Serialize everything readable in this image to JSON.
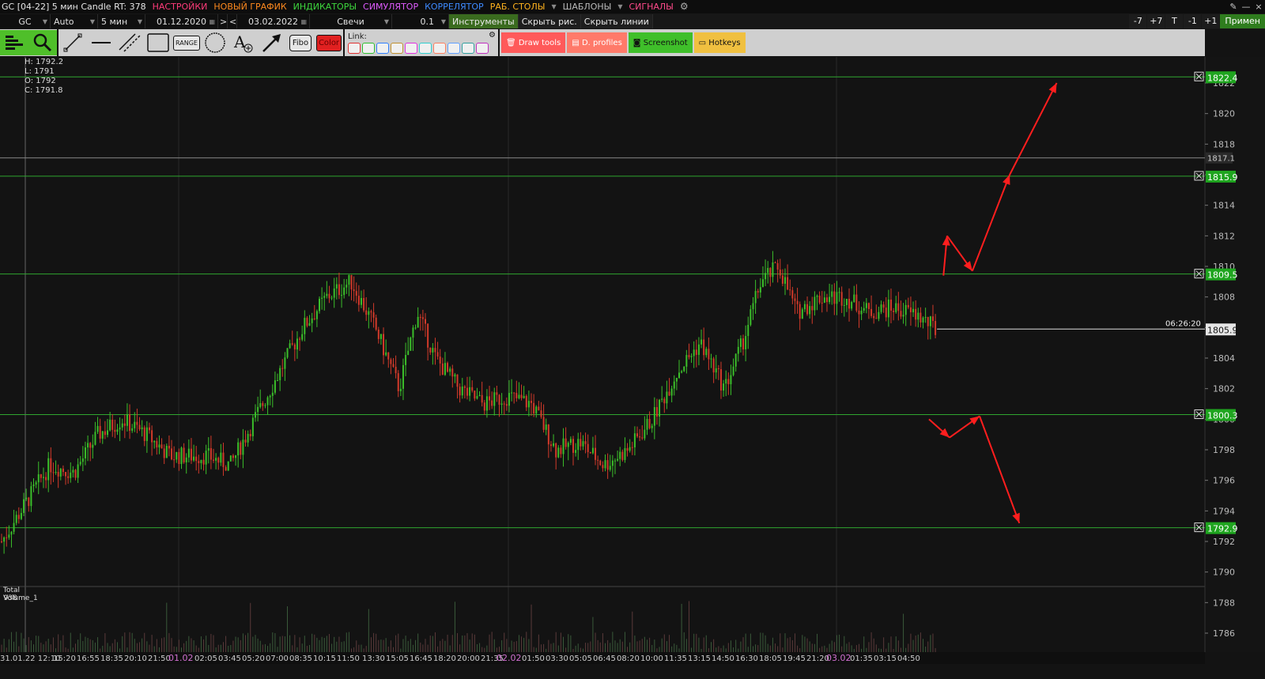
{
  "menu": {
    "title": "GC [04-22] 5 мин Candle RT: 378",
    "items": [
      {
        "label": "НАСТРОЙКИ",
        "color": "#ff3b7a"
      },
      {
        "label": "НОВЫЙ ГРАФИК",
        "color": "#ff8a1e"
      },
      {
        "label": "ИНДИКАТОРЫ",
        "color": "#3dd63d"
      },
      {
        "label": "СИМУЛЯТОР",
        "color": "#e05cff"
      },
      {
        "label": "КОРРЕЛЯТОР",
        "color": "#3d8aff"
      },
      {
        "label": "РАБ. СТОЛЫ",
        "color": "#ffb21e"
      },
      {
        "label": "ШАБЛОНЫ",
        "color": "#bbbbbb"
      },
      {
        "label": "СИГНАЛЫ",
        "color": "#ff4a8a"
      }
    ],
    "pin": "✎",
    "minimize": "—",
    "close": "×"
  },
  "toolbar": {
    "symbol": "GC",
    "mode": "Auto",
    "timeframe": "5 мин",
    "date_from": "01.12.2020",
    "nav_right": ">",
    "nav_left": "<",
    "date_to": "03.02.2022",
    "chart_type": "Свечи",
    "step": "0.1",
    "tools_label": "Инструменты",
    "hide_drawings": "Скрыть рис.",
    "hide_lines": "Скрыть линии",
    "zoom_minus7": "-7",
    "zoom_plus7": "+7",
    "zoom_t": "T",
    "zoom_minus1": "-1",
    "zoom_plus1": "+1",
    "apply": "Примен"
  },
  "drawbar": {
    "range_label": "RANGE",
    "fibo_label": "Fibo",
    "color_label": "Color",
    "link_label": "Link:",
    "link_colors": [
      "#e03030",
      "#30c030",
      "#3080ff",
      "#c09030",
      "#e030e0",
      "#30d0d0",
      "#ff8060",
      "#60a0ff",
      "#30a0a0",
      "#c030c0"
    ],
    "draw_tools": "Draw tools",
    "d_profiles": "D. profiles",
    "screenshot": "Screenshot",
    "hotkeys": "Hotkeys",
    "colors": {
      "draw_tools": "#ff5a5a",
      "d_profiles": "#ff7a6a",
      "screenshot": "#3fbf2a",
      "hotkeys": "#f0c040"
    }
  },
  "ohlc": {
    "h": "H: 1792.2",
    "l": "L: 1791",
    "o": "O: 1792",
    "c": "C: 1791.8"
  },
  "volume_label": "Total Volume_1",
  "volume_value": "938",
  "current_time": "06:26:20",
  "current_price": "1805.9",
  "price_ticks": [
    "1822",
    "1820",
    "1818",
    "1816",
    "1814",
    "1812",
    "1810",
    "1808",
    "1806",
    "1804",
    "1802",
    "1800",
    "1798",
    "1796",
    "1794",
    "1792",
    "1790",
    "1788",
    "1786"
  ],
  "levels": [
    {
      "price": "1822.4",
      "color": "#2fa52f"
    },
    {
      "price": "1815.9",
      "color": "#2fa52f"
    },
    {
      "price": "1809.5",
      "color": "#2fa52f"
    },
    {
      "price": "1800.3",
      "color": "#2fa52f"
    },
    {
      "price": "1792.9",
      "color": "#2fa52f"
    }
  ],
  "grey_level": "1817.1",
  "time_labels": [
    "31.01.22 12:10",
    "15:20",
    "16:55",
    "18:35",
    "20:10",
    "21:50",
    "01.02",
    "02:05",
    "03:45",
    "05:20",
    "07:00",
    "08:35",
    "10:15",
    "11:50",
    "13:30",
    "15:05",
    "16:45",
    "18:20",
    "20:00",
    "21:35",
    "02.02",
    "01:50",
    "03:30",
    "05:05",
    "06:45",
    "08:20",
    "10:00",
    "11:35",
    "13:15",
    "14:50",
    "16:30",
    "18:05",
    "19:45",
    "21:20",
    "03.02",
    "01:35",
    "03:15",
    "04:50"
  ],
  "chart_data": {
    "type": "candlestick",
    "title": "GC [04-22] 5 мин Candle",
    "ylim": [
      1785,
      1823
    ],
    "close_path": [
      {
        "t": 0,
        "p": 1792
      },
      {
        "t": 0.04,
        "p": 1797
      },
      {
        "t": 0.06,
        "p": 1796.5
      },
      {
        "t": 0.08,
        "p": 1799
      },
      {
        "t": 0.1,
        "p": 1800
      },
      {
        "t": 0.12,
        "p": 1799
      },
      {
        "t": 0.14,
        "p": 1797.6
      },
      {
        "t": 0.17,
        "p": 1797.6
      },
      {
        "t": 0.19,
        "p": 1797
      },
      {
        "t": 0.21,
        "p": 1800
      },
      {
        "t": 0.23,
        "p": 1803
      },
      {
        "t": 0.25,
        "p": 1806
      },
      {
        "t": 0.27,
        "p": 1808
      },
      {
        "t": 0.29,
        "p": 1809
      },
      {
        "t": 0.31,
        "p": 1806
      },
      {
        "t": 0.33,
        "p": 1802
      },
      {
        "t": 0.345,
        "p": 1807
      },
      {
        "t": 0.36,
        "p": 1804
      },
      {
        "t": 0.38,
        "p": 1802
      },
      {
        "t": 0.4,
        "p": 1801
      },
      {
        "t": 0.42,
        "p": 1801.5
      },
      {
        "t": 0.44,
        "p": 1801
      },
      {
        "t": 0.46,
        "p": 1798
      },
      {
        "t": 0.48,
        "p": 1798.5
      },
      {
        "t": 0.5,
        "p": 1797
      },
      {
        "t": 0.52,
        "p": 1798
      },
      {
        "t": 0.54,
        "p": 1800
      },
      {
        "t": 0.56,
        "p": 1803
      },
      {
        "t": 0.58,
        "p": 1805
      },
      {
        "t": 0.6,
        "p": 1802
      },
      {
        "t": 0.615,
        "p": 1805
      },
      {
        "t": 0.63,
        "p": 1809
      },
      {
        "t": 0.645,
        "p": 1810
      },
      {
        "t": 0.66,
        "p": 1807
      },
      {
        "t": 0.68,
        "p": 1808
      },
      {
        "t": 0.7,
        "p": 1808
      },
      {
        "t": 0.72,
        "p": 1807
      },
      {
        "t": 0.74,
        "p": 1807.3
      },
      {
        "t": 0.76,
        "p": 1806.8
      },
      {
        "t": 0.775,
        "p": 1805.9
      }
    ],
    "arrows": [
      {
        "from": [
          0.783,
          1809.4
        ],
        "to": [
          0.786,
          1812
        ],
        "color": "#ff1e1e"
      },
      {
        "from": [
          0.786,
          1812
        ],
        "to": [
          0.807,
          1809.7
        ],
        "color": "#ff1e1e"
      },
      {
        "from": [
          0.807,
          1809.7
        ],
        "to": [
          0.838,
          1816
        ],
        "color": "#ff1e1e"
      },
      {
        "from": [
          0.838,
          1816
        ],
        "to": [
          0.877,
          1822
        ],
        "color": "#ff1e1e"
      },
      {
        "from": [
          0.771,
          1800
        ],
        "to": [
          0.788,
          1798.8
        ],
        "color": "#ff1e1e"
      },
      {
        "from": [
          0.788,
          1798.8
        ],
        "to": [
          0.813,
          1800.2
        ],
        "color": "#ff1e1e"
      },
      {
        "from": [
          0.813,
          1800.2
        ],
        "to": [
          0.846,
          1793.2
        ],
        "color": "#ff1e1e"
      }
    ]
  }
}
